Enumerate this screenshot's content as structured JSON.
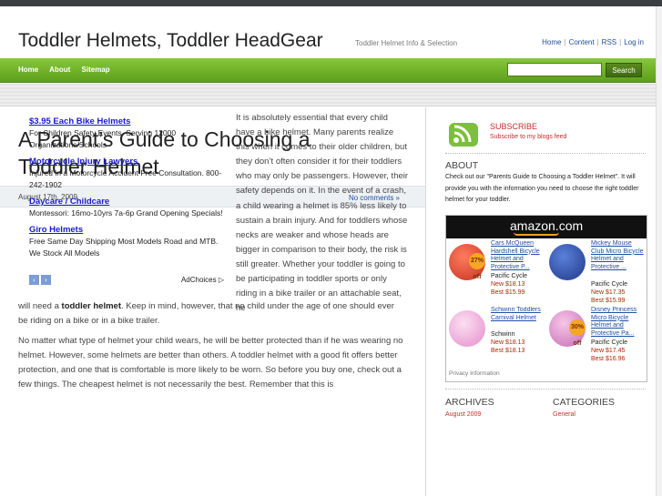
{
  "header": {
    "site_title": "Toddler Helmets, Toddler HeadGear",
    "tagline": "Toddler Helmet Info & Selection",
    "top_links": [
      "Home",
      "Content",
      "RSS",
      "Log in"
    ]
  },
  "nav": {
    "items": [
      "Home",
      "About",
      "Sitemap"
    ],
    "search_placeholder": "",
    "search_button": "Search"
  },
  "post": {
    "title": "A Parent’s Guide to Choosing a Toddler Helmet",
    "date": "August 17th, 2009",
    "comments": "No comments »",
    "para1_right": "It is absolutely essential that every child have a bike helmet. Many parents realize this when it comes to their older children, but they don’t often consider it for their toddlers who may only be passengers. However, their safety depends on it. In the event of a crash, a child wearing a helmet is 85% less likely to sustain a brain injury. And for toddlers whose necks are weaker and whose heads are bigger in comparison to their body, the risk is still greater. Whether your toddler is going to be participating in toddler sports or only riding in a bike trailer or an attachable seat, he",
    "para1_cont_pre": "will need a ",
    "para1_cont_bold": "toddler helmet",
    "para1_cont_post": ". Keep in mind, however, that no child under the age of one should ever be riding on a bike or in a bike trailer.",
    "para2": "No matter what type of helmet your child wears, he will be better protected than if he was wearing no helmet. However, some helmets are better than others. A toddler helmet with a good fit offers better protection, and one that is comfortable is more likely to be worn. So before you buy one, check out a few things. The cheapest helmet is not necessarily the best. Remember that this is"
  },
  "ads": {
    "items": [
      {
        "title": "$3.95 Each Bike Helmets",
        "desc": "For Children Safety Events. Serving 12000 Organizations/Schools"
      },
      {
        "title": "Motorcycle Injury Lawyers",
        "desc": "Injured in a Motorcycle Accident Free Consultation. 800-242-1902"
      },
      {
        "title": "Daycare / Childcare",
        "desc": "Montessori: 16mo-10yrs 7a-6p Grand Opening Specials!"
      },
      {
        "title": "Giro Helmets",
        "desc": "Free Same Day Shipping Most Models Road and MTB. We Stock All Models"
      }
    ],
    "prev_label": "‹",
    "next_label": "›",
    "adchoices": "AdChoices ▷"
  },
  "sidebar": {
    "subscribe_title": "SUBSCRIBE",
    "subscribe_sub": "Subscribe to my blogs feed",
    "about_heading": "ABOUT",
    "about_text": "Check out our \"Parents Guide to Choosing a Toddler Helmet\". It will provide you with the information you need to choose the right toddler helmet for your toddler.",
    "archives_heading": "ARCHIVES",
    "archives_link": "August 2009",
    "categories_heading": "CATEGORIES",
    "categories_link": "General"
  },
  "amazon": {
    "logo": "amazon.com",
    "privacy": "Privacy Information",
    "products": [
      {
        "name": "Cars McQueen Hardshell Bicycle Helmet and Protective P...",
        "brand": "Pacific Cycle",
        "new": "New $18.13",
        "best": "Best $15.99",
        "badge": "27% off",
        "color": "#d8412f"
      },
      {
        "name": "Mickey Mouse Club Micro Bicycle Helmet and Protective ...",
        "brand": "Pacific Cycle",
        "new": "New $17.35",
        "best": "Best $15.99",
        "badge": "",
        "color": "#2d4fa8"
      },
      {
        "name": "Schwinn Toddlers Carnival Helmet",
        "brand": "Schwinn",
        "new": "New $18.13",
        "best": "Best $18.13",
        "badge": "",
        "color": "#e9a3d4"
      },
      {
        "name": "Disney Princess Micro Bicycle Helmet and Protective Pa...",
        "brand": "Pacific Cycle",
        "new": "New $17.45",
        "best": "Best $16.96",
        "badge": "30% off",
        "color": "#d98fc8"
      }
    ]
  }
}
